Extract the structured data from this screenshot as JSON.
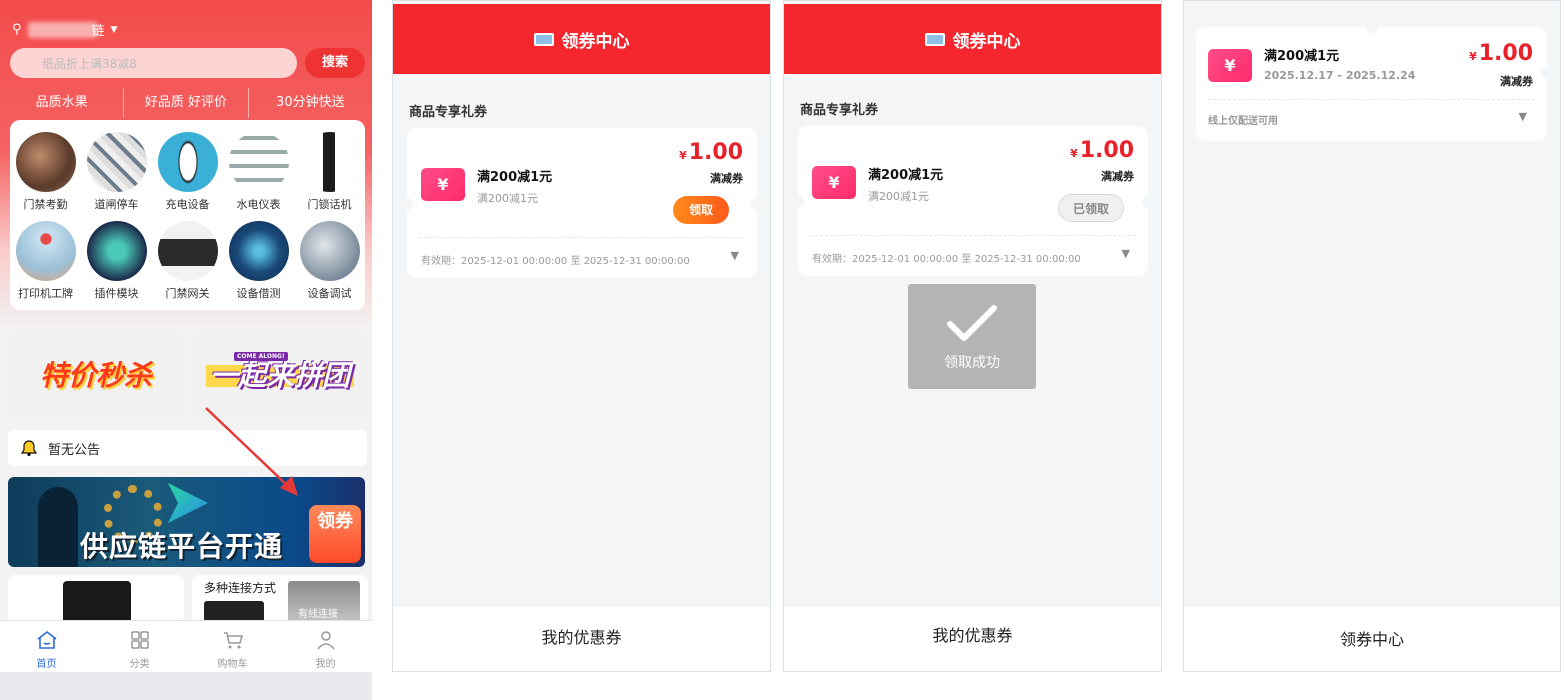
{
  "home": {
    "location_suffix": "链",
    "search_placeholder": "纸品折上满38减8",
    "search_button": "搜索",
    "slogans": [
      "品质水果",
      "好品质 好评价",
      "30分钟快送"
    ],
    "categories": [
      "门禁考勤",
      "道闸停车",
      "充电设备",
      "水电仪表",
      "门锁话机",
      "打印机工牌",
      "插件模块",
      "门禁网关",
      "设备借测",
      "设备调试"
    ],
    "promo_left": "特价秒杀",
    "promo_right": "一起来拼团",
    "promo_right_tag": "COME ALONG!",
    "notice": "暂无公告",
    "banner_text": "供应链平台开通",
    "banner_badge": "领券",
    "card_title": "多种连接方式",
    "card_tag": "有线连接",
    "tabs": [
      "首页",
      "分类",
      "购物车",
      "我的"
    ]
  },
  "coupon_center": {
    "title": "领券中心",
    "section": "商品专享礼券",
    "coupon_title": "满200减1元",
    "coupon_sub": "满200减1元",
    "currency": "¥",
    "amount": "1.00",
    "type": "满减券",
    "claim_button": "领取",
    "claimed_button": "已领取",
    "validity": "有效期：2025-12-01 00:00:00 至 2025-12-31 00:00:00",
    "toast": "领取成功",
    "footer": "我的优惠券"
  },
  "my_coupon": {
    "coupon_title": "满200减1元",
    "date_range": "2025.12.17 - 2025.12.24",
    "currency": "¥",
    "amount": "1.00",
    "type": "满减券",
    "note": "线上仅配送可用",
    "footer": "领券中心"
  },
  "colors": {
    "brand_red": "#f6262e",
    "price_red": "#e8212a",
    "claim_orange": "#ff6a1a",
    "tab_active": "#2a6ed8"
  }
}
